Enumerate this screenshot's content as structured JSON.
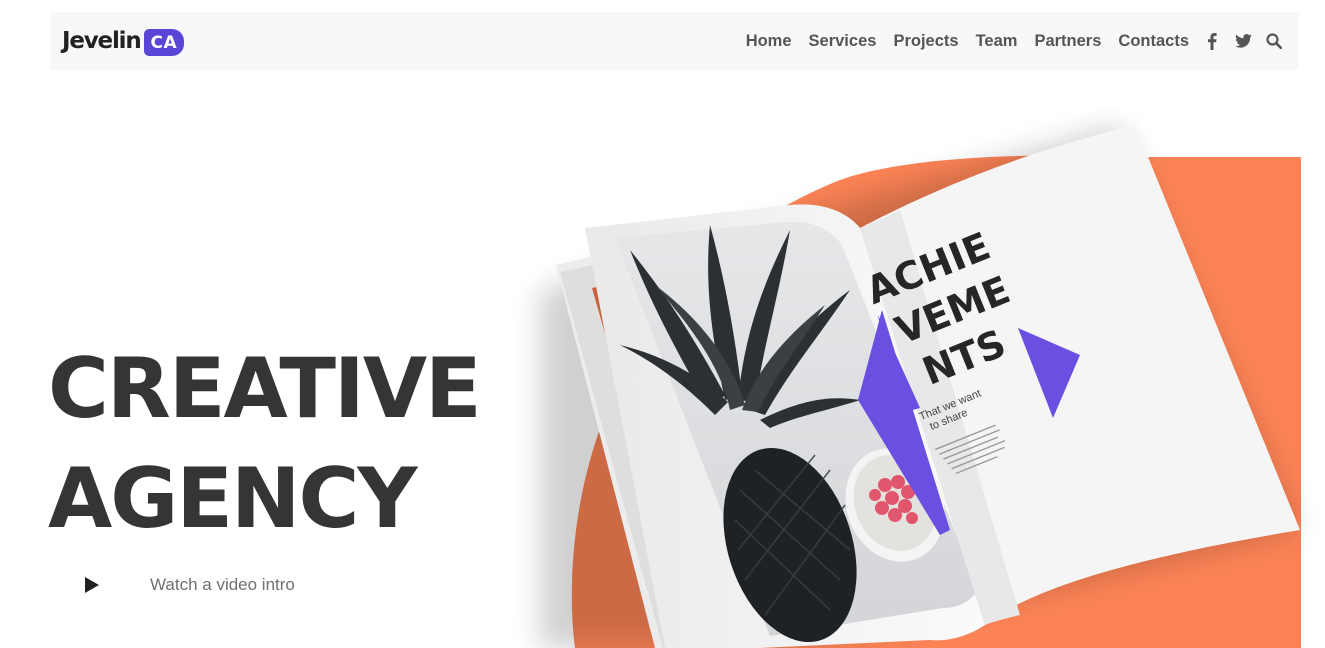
{
  "brand": {
    "name": "Jevelin",
    "badge": "CA",
    "accent": "#5a46d6"
  },
  "nav": {
    "items": [
      {
        "label": "Home"
      },
      {
        "label": "Services"
      },
      {
        "label": "Projects"
      },
      {
        "label": "Team"
      },
      {
        "label": "Partners"
      },
      {
        "label": "Contacts"
      }
    ],
    "icons": [
      "facebook-icon",
      "twitter-icon",
      "search-icon"
    ]
  },
  "hero": {
    "title_line1": "CREATIVE",
    "title_line2": "AGENCY",
    "video_label": "Watch a video intro"
  },
  "magazine": {
    "heading_line1": "ACHIE",
    "heading_line2": "VEME",
    "heading_line3": "NTS",
    "tagline_line1": "That we want",
    "tagline_line2": "to share"
  },
  "colors": {
    "orange": "#fb8356",
    "purple": "#6a4fe0",
    "title": "#353535",
    "header_bg": "#f7f8fa"
  }
}
